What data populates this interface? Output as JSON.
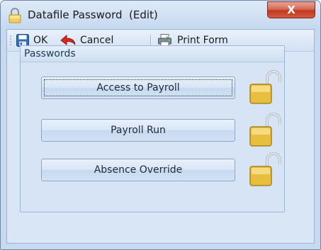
{
  "window": {
    "title": "Datafile Password  (Edit)",
    "close_glyph": "X"
  },
  "toolbar": {
    "ok_label": "OK",
    "cancel_label": "Cancel",
    "print_label": "Print Form",
    "icons": {
      "ok": "save-icon",
      "cancel": "back-arrow-icon",
      "print": "print-icon"
    }
  },
  "group": {
    "title": "Passwords",
    "buttons": [
      {
        "label": "Access to Payroll",
        "lock_state": "unlocked",
        "focused": true
      },
      {
        "label": "Payroll Run",
        "lock_state": "unlocked",
        "focused": false
      },
      {
        "label": "Absence Override",
        "lock_state": "unlocked",
        "focused": false
      }
    ]
  },
  "colors": {
    "accent": "#1e395b",
    "lock_body": "#e8c24a",
    "close_button": "#c0391f"
  }
}
